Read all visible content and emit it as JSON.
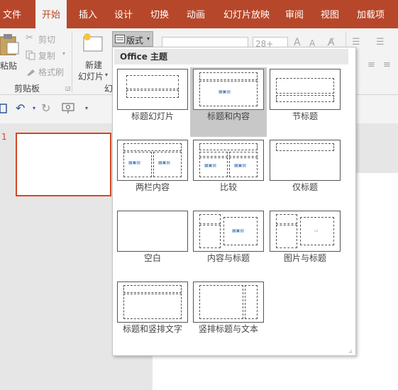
{
  "tabs": [
    "文件",
    "开始",
    "插入",
    "设计",
    "切换",
    "动画",
    "幻灯片放映",
    "审阅",
    "视图",
    "加载项"
  ],
  "ribbon": {
    "paste_label": "粘贴",
    "cut_label": "剪切",
    "copy_label": "复制",
    "format_painter_label": "格式刷",
    "clipboard_group": "剪贴板",
    "new_label_1": "新建",
    "new_label_2": "幻灯片",
    "layout_label": "版式",
    "slides_group_partial": "幻",
    "font_size": "28+"
  },
  "slide_number": "1",
  "dropdown": {
    "header": "Office 主题",
    "layouts": [
      {
        "name": "标题幻灯片",
        "selected": false
      },
      {
        "name": "标题和内容",
        "selected": true
      },
      {
        "name": "节标题",
        "selected": false
      },
      {
        "name": "两栏内容",
        "selected": false
      },
      {
        "name": "比较",
        "selected": false
      },
      {
        "name": "仅标题",
        "selected": false
      },
      {
        "name": "空白",
        "selected": false
      },
      {
        "name": "内容与标题",
        "selected": false
      },
      {
        "name": "图片与标题",
        "selected": false
      },
      {
        "name": "标题和竖排文字",
        "selected": false
      },
      {
        "name": "竖排标题与文本",
        "selected": false
      }
    ]
  },
  "colors": {
    "accent": "#b7472a",
    "selection": "#d24726"
  }
}
